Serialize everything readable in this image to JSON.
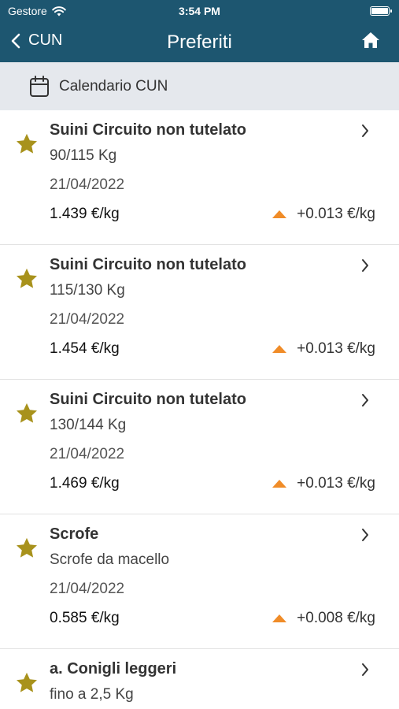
{
  "status_bar": {
    "carrier": "Gestore",
    "time": "3:54 PM"
  },
  "nav": {
    "back_label": "CUN",
    "title": "Preferiti"
  },
  "calendar_bar": {
    "label": "Calendario CUN"
  },
  "colors": {
    "header": "#1d5670",
    "star": "#a8921c",
    "up_arrow": "#f08c28",
    "calendar_bar": "#e5e8ed"
  },
  "favorites": [
    {
      "name": "Suini Circuito non tutelato",
      "subtitle": "90/115 Kg",
      "date": "21/04/2022",
      "price": "1.439 €/kg",
      "change": "+0.013 €/kg",
      "trend": "up"
    },
    {
      "name": "Suini Circuito non tutelato",
      "subtitle": "115/130 Kg",
      "date": "21/04/2022",
      "price": "1.454 €/kg",
      "change": "+0.013 €/kg",
      "trend": "up"
    },
    {
      "name": "Suini Circuito non tutelato",
      "subtitle": "130/144 Kg",
      "date": "21/04/2022",
      "price": "1.469 €/kg",
      "change": "+0.013 €/kg",
      "trend": "up"
    },
    {
      "name": "Scrofe",
      "subtitle": "Scrofe da macello",
      "date": "21/04/2022",
      "price": "0.585 €/kg",
      "change": "+0.008 €/kg",
      "trend": "up"
    },
    {
      "name": "a. Conigli leggeri",
      "subtitle": "fino a 2,5 Kg"
    }
  ]
}
